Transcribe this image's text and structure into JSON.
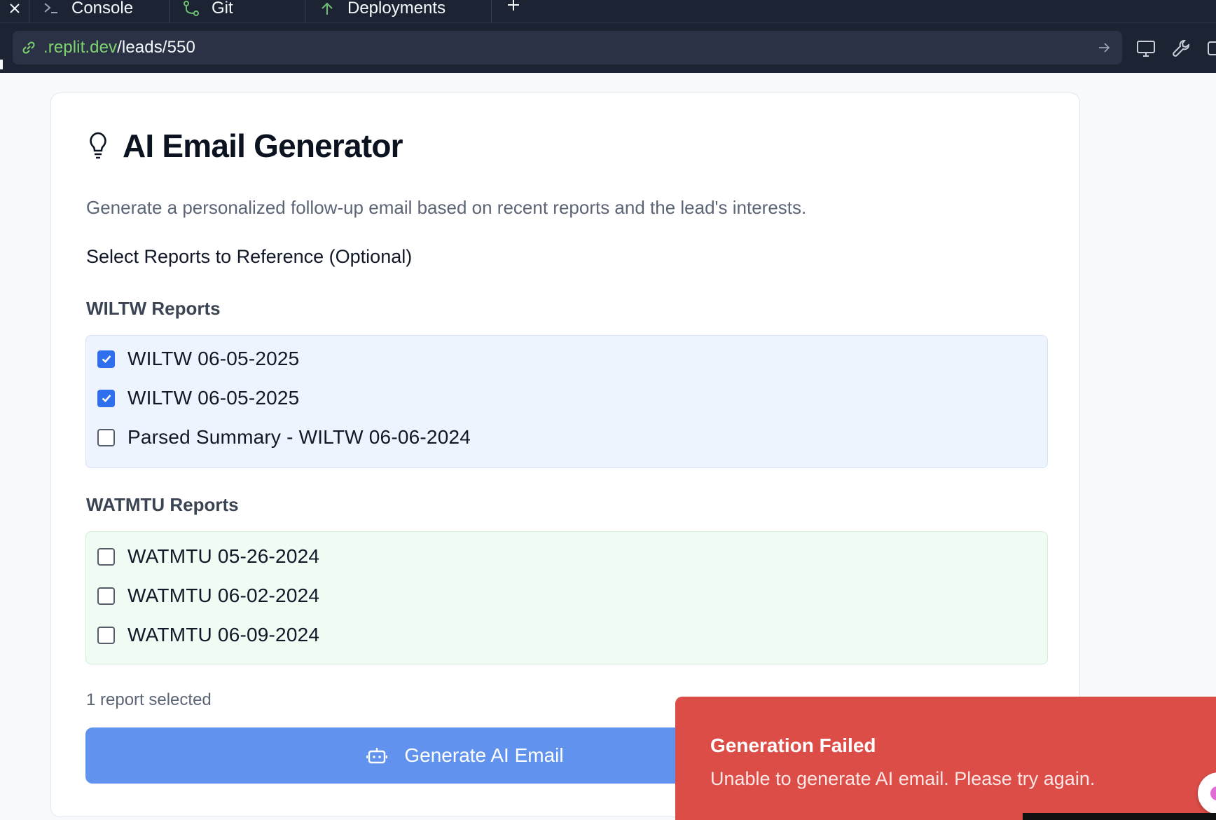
{
  "ide": {
    "tabs": [
      {
        "label": "Console",
        "icon": "terminal-icon"
      },
      {
        "label": "Git",
        "icon": "git-branch-icon"
      },
      {
        "label": "Deployments",
        "icon": "deploy-icon"
      }
    ],
    "url": {
      "domain": ".replit.dev",
      "path": "/leads/550"
    }
  },
  "card": {
    "title": "AI Email Generator",
    "description": "Generate a personalized follow-up email based on recent reports and the lead's interests.",
    "select_label": "Select Reports to Reference (Optional)",
    "wiltw": {
      "label": "WILTW Reports",
      "items": [
        {
          "label": "WILTW 06-05-2025",
          "checked": true
        },
        {
          "label": "WILTW 06-05-2025",
          "checked": true
        },
        {
          "label": "Parsed Summary - WILTW 06-06-2024",
          "checked": false
        }
      ]
    },
    "watmtu": {
      "label": "WATMTU Reports",
      "items": [
        {
          "label": "WATMTU 05-26-2024",
          "checked": false
        },
        {
          "label": "WATMTU 06-02-2024",
          "checked": false
        },
        {
          "label": "WATMTU 06-09-2024",
          "checked": false
        }
      ]
    },
    "selected_count": "1 report selected",
    "generate_button": "Generate AI Email"
  },
  "toast": {
    "title": "Generation Failed",
    "message": "Unable to generate AI email. Please try again."
  },
  "colors": {
    "accent": "#2f6fed",
    "button": "#6193ee",
    "toast_error": "#dc4d48",
    "url_domain": "#7ed36f"
  }
}
